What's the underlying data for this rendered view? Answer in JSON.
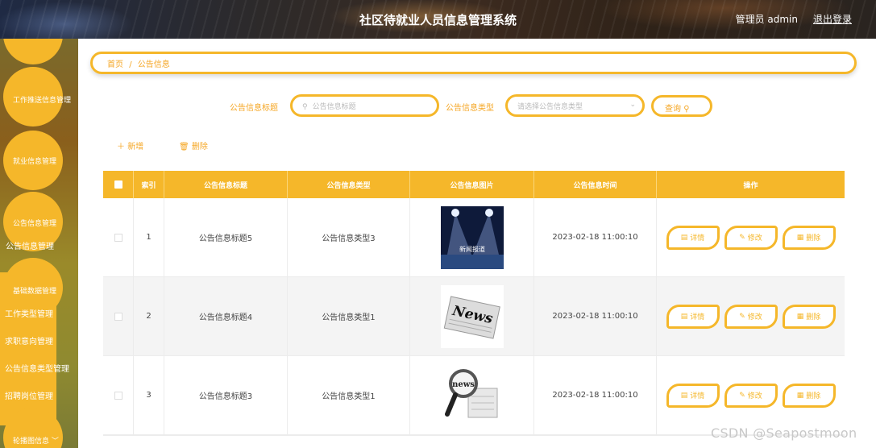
{
  "header": {
    "title": "社区待就业人员信息管理系统",
    "user": "管理员 admin",
    "logout": "退出登录"
  },
  "sidebar": {
    "items": [
      {
        "label": "工作推送信息管理"
      },
      {
        "label": "就业信息管理"
      },
      {
        "label": "公告信息管理"
      },
      {
        "label": "公告信息管理"
      },
      {
        "label": "基础数据管理"
      },
      {
        "label": "工作类型管理"
      },
      {
        "label": "求职意向管理"
      },
      {
        "label": "公告信息类型管理"
      },
      {
        "label": "招聘岗位管理"
      },
      {
        "label": "轮播图信息"
      },
      {
        "label": "﹀"
      }
    ]
  },
  "breadcrumb": {
    "home": "首页",
    "sep": "/",
    "current": "公告信息"
  },
  "search": {
    "title_label": "公告信息标题",
    "title_placeholder": "公告信息标题",
    "type_label": "公告信息类型",
    "type_placeholder": "请选择公告信息类型",
    "query": "查询"
  },
  "actions": {
    "add": "新增",
    "delete": "删除"
  },
  "table": {
    "headers": [
      "索引",
      "公告信息标题",
      "公告信息类型",
      "公告信息图片",
      "公告信息时间",
      "操作"
    ],
    "rows": [
      {
        "index": "1",
        "title": "公告信息标题5",
        "type": "公告信息类型3",
        "image": "news-stage-image",
        "time": "2023-02-18 11:00:10"
      },
      {
        "index": "2",
        "title": "公告信息标题4",
        "type": "公告信息类型1",
        "image": "news-paper-image",
        "time": "2023-02-18 11:00:10"
      },
      {
        "index": "3",
        "title": "公告信息标题3",
        "type": "公告信息类型1",
        "image": "news-magnifier-image",
        "time": "2023-02-18 11:00:10"
      }
    ],
    "ops": {
      "detail": "详情",
      "edit": "修改",
      "delete": "删除"
    },
    "image_caption": "新闻报道"
  },
  "watermark": "CSDN @Seapostmoon",
  "colors": {
    "accent": "#f5b72a",
    "text_accent": "#f5a623"
  }
}
